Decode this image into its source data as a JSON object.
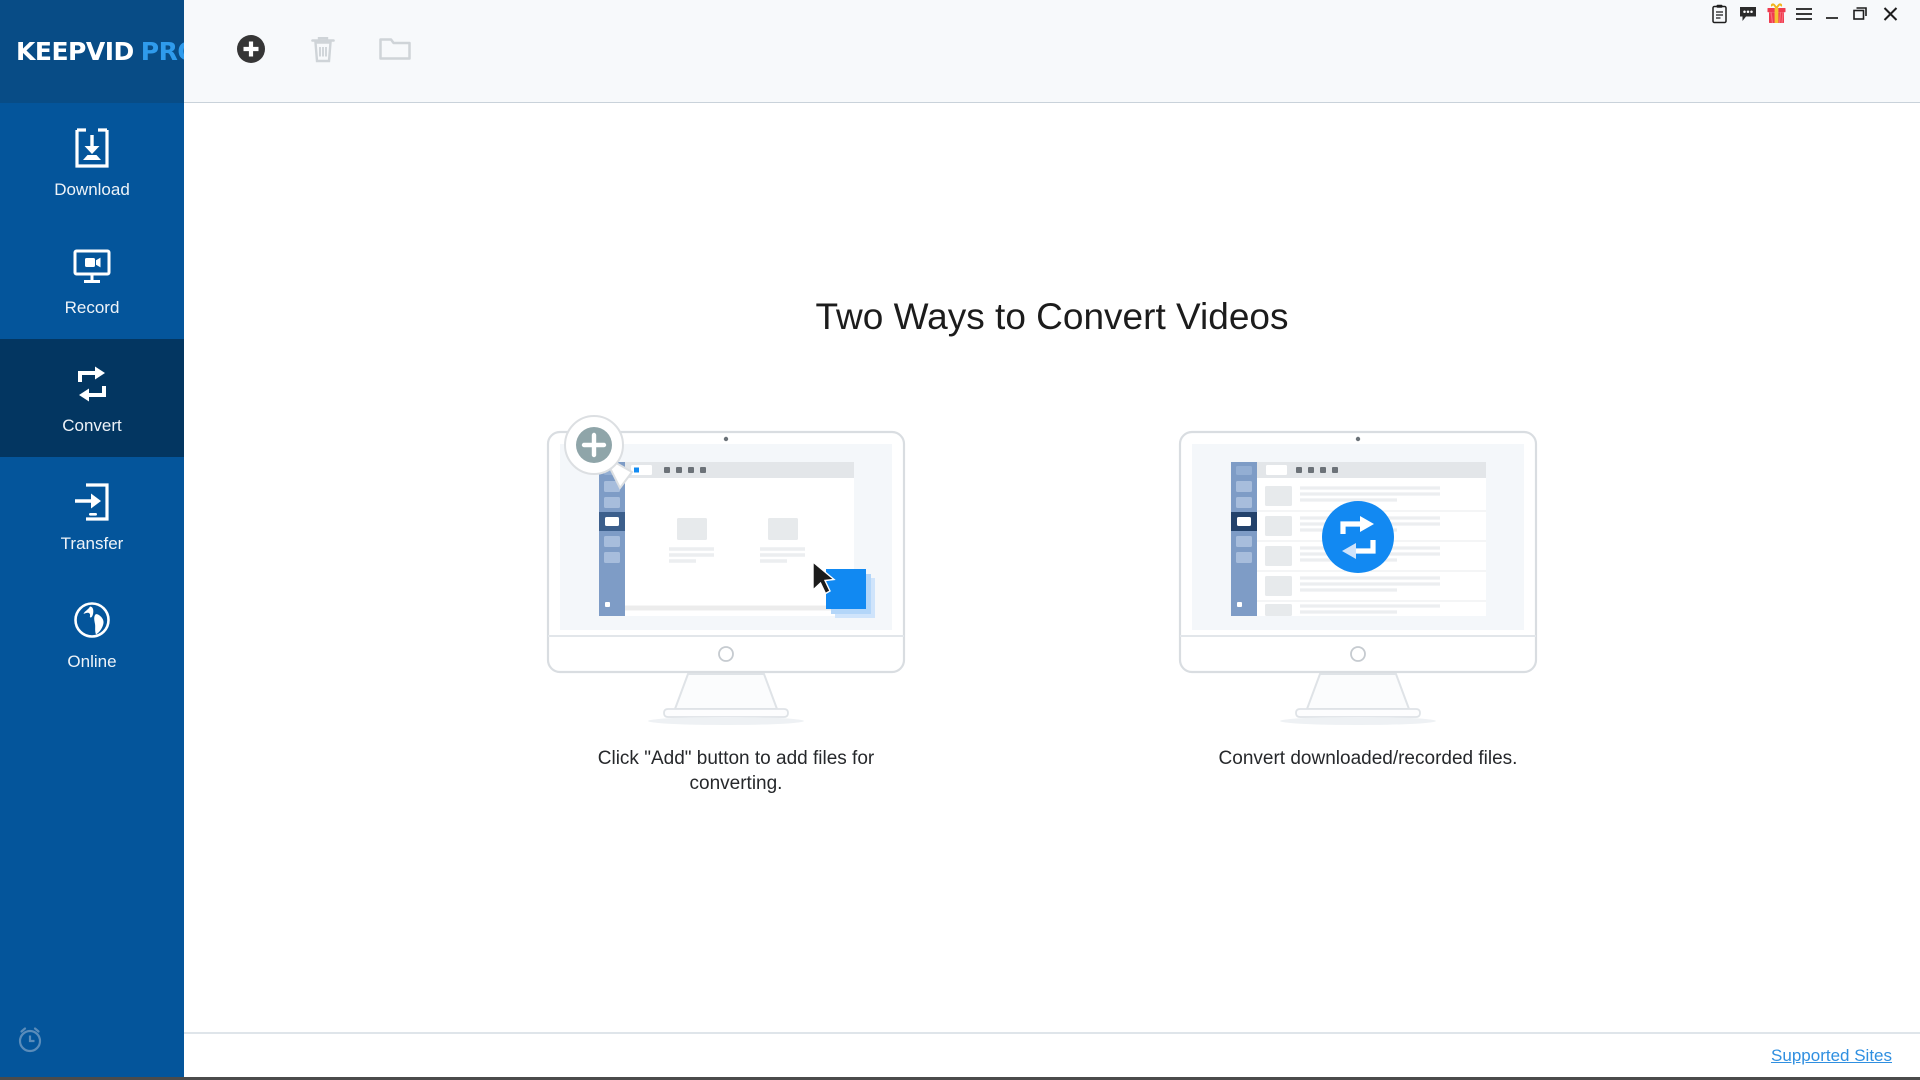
{
  "app": {
    "logo_primary": "KEEPVID",
    "logo_secondary": "PRO",
    "brand_blue": "#04559b",
    "brand_blue_dark": "#033661",
    "accent_blue": "#2f9bec",
    "link_blue": "#2f8fe0"
  },
  "sidebar": {
    "items": [
      {
        "label": "Download",
        "icon": "download-box-icon",
        "active": false
      },
      {
        "label": "Record",
        "icon": "screen-record-icon",
        "active": false
      },
      {
        "label": "Convert",
        "icon": "convert-loop-icon",
        "active": true
      },
      {
        "label": "Transfer",
        "icon": "transfer-device-icon",
        "active": false
      },
      {
        "label": "Online",
        "icon": "globe-icon",
        "active": false
      }
    ],
    "bottom_icon": "alarm-clock-icon"
  },
  "toolbar": {
    "buttons": [
      {
        "name": "add-button",
        "icon": "plus-circle-icon",
        "label": "Add",
        "enabled": true
      },
      {
        "name": "delete-button",
        "icon": "trash-icon",
        "label": "Delete",
        "enabled": false
      },
      {
        "name": "folder-button",
        "icon": "folder-icon",
        "label": "Open Folder",
        "enabled": false
      }
    ]
  },
  "titlebar": {
    "icons": [
      {
        "name": "log-clipboard-icon",
        "label": "Log"
      },
      {
        "name": "feedback-chat-icon",
        "label": "Feedback"
      },
      {
        "name": "gift-icon",
        "label": "Gift"
      },
      {
        "name": "menu-hamburger-icon",
        "label": "Menu"
      },
      {
        "name": "minimize-icon",
        "label": "Minimize"
      },
      {
        "name": "maximize-icon",
        "label": "Maximize"
      },
      {
        "name": "close-icon",
        "label": "Close"
      }
    ]
  },
  "main": {
    "headline": "Two Ways to Convert Videos",
    "cards": [
      {
        "illustration": "monitor-add-files-illustration",
        "caption": "Click \"Add\" button to add files for converting."
      },
      {
        "illustration": "monitor-convert-illustration",
        "caption": "Convert downloaded/recorded files."
      }
    ]
  },
  "statusbar": {
    "supported_sites_link": "Supported Sites"
  }
}
